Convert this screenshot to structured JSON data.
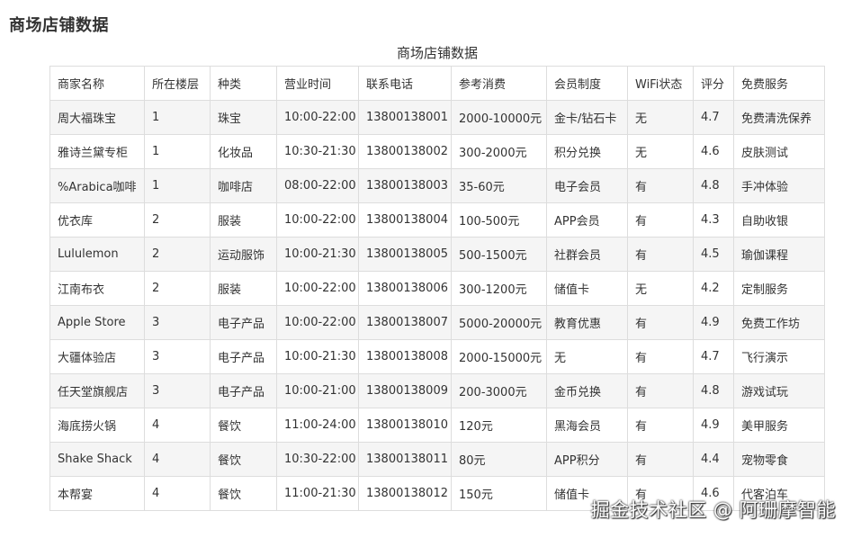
{
  "page": {
    "title": "商场店铺数据"
  },
  "table": {
    "caption": "商场店铺数据",
    "headers": [
      "商家名称",
      "所在楼层",
      "种类",
      "营业时间",
      "联系电话",
      "参考消费",
      "会员制度",
      "WiFi状态",
      "评分",
      "免费服务"
    ],
    "rows": [
      [
        "周大福珠宝",
        "1",
        "珠宝",
        "10:00-22:00",
        "13800138001",
        "2000-10000元",
        "金卡/钻石卡",
        "无",
        "4.7",
        "免费清洗保养"
      ],
      [
        "雅诗兰黛专柜",
        "1",
        "化妆品",
        "10:30-21:30",
        "13800138002",
        "300-2000元",
        "积分兑换",
        "无",
        "4.6",
        "皮肤测试"
      ],
      [
        "%Arabica咖啡",
        "1",
        "咖啡店",
        "08:00-22:00",
        "13800138003",
        "35-60元",
        "电子会员",
        "有",
        "4.8",
        "手冲体验"
      ],
      [
        "优衣库",
        "2",
        "服装",
        "10:00-22:00",
        "13800138004",
        "100-500元",
        "APP会员",
        "有",
        "4.3",
        "自助收银"
      ],
      [
        "Lululemon",
        "2",
        "运动服饰",
        "10:00-21:30",
        "13800138005",
        "500-1500元",
        "社群会员",
        "有",
        "4.5",
        "瑜伽课程"
      ],
      [
        "江南布衣",
        "2",
        "服装",
        "10:00-22:00",
        "13800138006",
        "300-1200元",
        "储值卡",
        "无",
        "4.2",
        "定制服务"
      ],
      [
        "Apple Store",
        "3",
        "电子产品",
        "10:00-22:00",
        "13800138007",
        "5000-20000元",
        "教育优惠",
        "有",
        "4.9",
        "免费工作坊"
      ],
      [
        "大疆体验店",
        "3",
        "电子产品",
        "10:00-21:30",
        "13800138008",
        "2000-15000元",
        "无",
        "有",
        "4.7",
        "飞行演示"
      ],
      [
        "任天堂旗舰店",
        "3",
        "电子产品",
        "10:00-21:00",
        "13800138009",
        "200-3000元",
        "金币兑换",
        "有",
        "4.8",
        "游戏试玩"
      ],
      [
        "海底捞火锅",
        "4",
        "餐饮",
        "11:00-24:00",
        "13800138010",
        "120元",
        "黑海会员",
        "有",
        "4.9",
        "美甲服务"
      ],
      [
        "Shake Shack",
        "4",
        "餐饮",
        "10:30-22:00",
        "13800138011",
        "80元",
        "APP积分",
        "有",
        "4.4",
        "宠物零食"
      ],
      [
        "本帮宴",
        "4",
        "餐饮",
        "11:00-21:30",
        "13800138012",
        "150元",
        "储值卡",
        "有",
        "4.6",
        "代客泊车"
      ]
    ]
  },
  "watermark": {
    "text": "掘金技术社区 @ 阿珊摩智能"
  }
}
